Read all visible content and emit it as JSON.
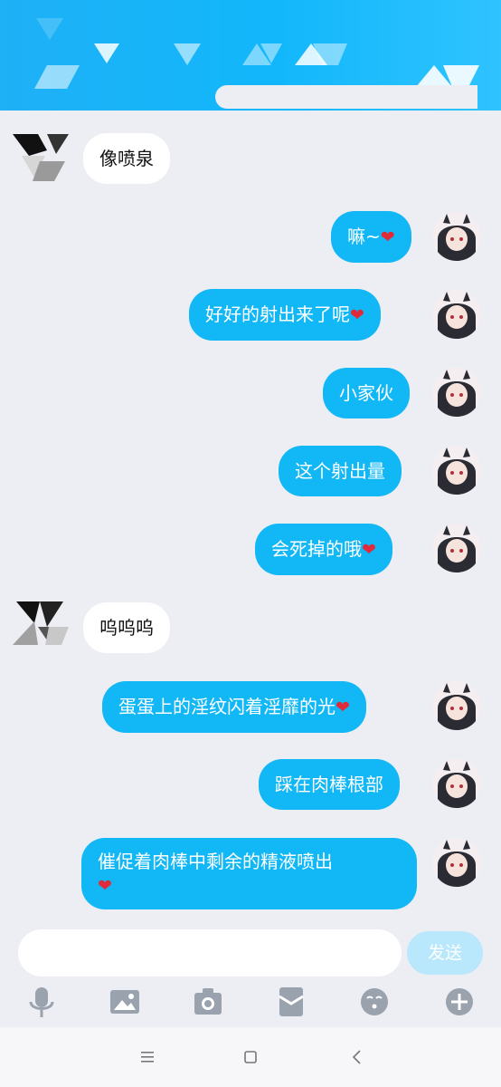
{
  "colors": {
    "header_blue": "#12b7fb",
    "sent_bubble": "#12b7f5",
    "received_bubble": "#ffffff",
    "background": "#eceef4",
    "send_button": "#b9e7fb",
    "heart": "#e02a3a"
  },
  "messages": [
    {
      "sender": "them",
      "text": "像喷泉",
      "emoji": ""
    },
    {
      "sender": "me",
      "text": "嘛~",
      "emoji": "❤"
    },
    {
      "sender": "me",
      "text": "好好的射出来了呢",
      "emoji": "❤"
    },
    {
      "sender": "me",
      "text": "小家伙",
      "emoji": ""
    },
    {
      "sender": "me",
      "text": "这个射出量",
      "emoji": ""
    },
    {
      "sender": "me",
      "text": "会死掉的哦",
      "emoji": "❤"
    },
    {
      "sender": "them",
      "text": "呜呜呜",
      "emoji": ""
    },
    {
      "sender": "me",
      "text": "蛋蛋上的淫纹闪着淫靡的光",
      "emoji": "❤"
    },
    {
      "sender": "me",
      "text": "踩在肉棒根部",
      "emoji": ""
    },
    {
      "sender": "me",
      "text": "催促着肉棒中剩余的精液喷出",
      "emoji": "❤"
    }
  ],
  "composer": {
    "input_value": "",
    "send_label": "发送"
  },
  "toolbar": [
    "microphone-icon",
    "image-icon",
    "camera-icon",
    "red-packet-icon",
    "emoji-icon",
    "plus-icon"
  ],
  "system_nav": [
    "menu-icon",
    "home-icon",
    "back-icon"
  ]
}
